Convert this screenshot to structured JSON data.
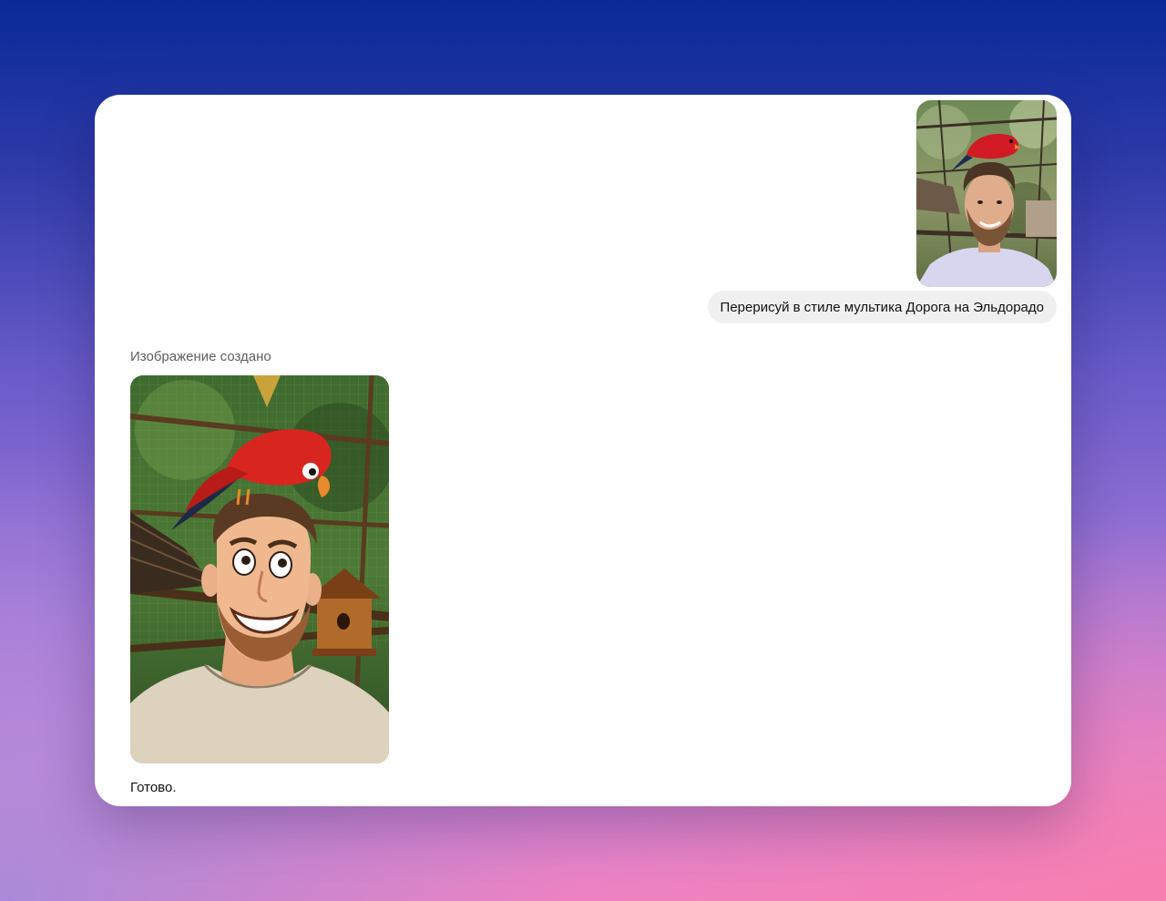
{
  "conversation": {
    "user_message": {
      "photo_icon": "user-photo",
      "text": "Перерисуй в стиле мультика Дорога на Эльдорадо"
    },
    "assistant_message": {
      "status_label": "Изображение создано",
      "image_icon": "generated-cartoon-image",
      "reply_text": "Готово."
    }
  },
  "colors": {
    "window_background": "#ffffff",
    "bubble_background": "#f0f0f1",
    "muted_text": "#5f5f5f",
    "text": "#111111"
  }
}
